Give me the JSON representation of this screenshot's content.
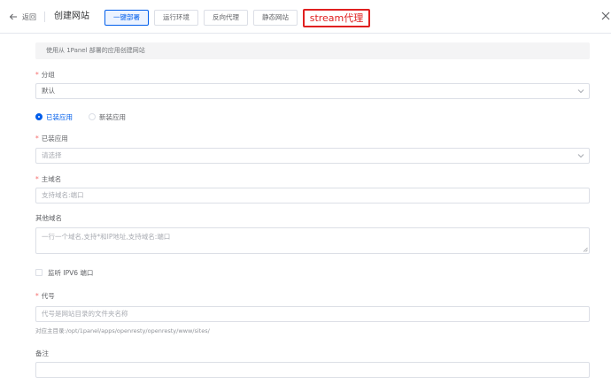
{
  "header": {
    "back_label": "返回",
    "title": "创建网站",
    "tabs": [
      {
        "label": "一键部署",
        "active": true
      },
      {
        "label": "运行环境",
        "active": false
      },
      {
        "label": "反向代理",
        "active": false
      },
      {
        "label": "静态网站",
        "active": false
      }
    ],
    "annotation": "stream代理"
  },
  "form": {
    "notice": "使用从 1Panel 部署的应用创建网站",
    "group": {
      "label": "分组",
      "value": "默认"
    },
    "app_type": {
      "options": [
        {
          "label": "已装应用",
          "selected": true
        },
        {
          "label": "新装应用",
          "selected": false
        }
      ]
    },
    "installed_app": {
      "label": "已装应用",
      "placeholder": "请选择"
    },
    "primary_domain": {
      "label": "主域名",
      "placeholder": "支持域名:端口"
    },
    "other_domains": {
      "label": "其他域名",
      "placeholder": "一行一个域名,支持*和IP地址,支持域名:端口"
    },
    "ipv6": {
      "label": "监听 IPV6 端口",
      "checked": false
    },
    "alias": {
      "label": "代号",
      "placeholder": "代号是网站目录的文件夹名称",
      "hint": "对应主目录:/opt/1panel/apps/openresty/openresty/www/sites/"
    },
    "remark": {
      "label": "备注",
      "value": ""
    }
  },
  "colors": {
    "primary": "#005eeb",
    "required": "#f56c6c",
    "annotation": "#e02020"
  }
}
